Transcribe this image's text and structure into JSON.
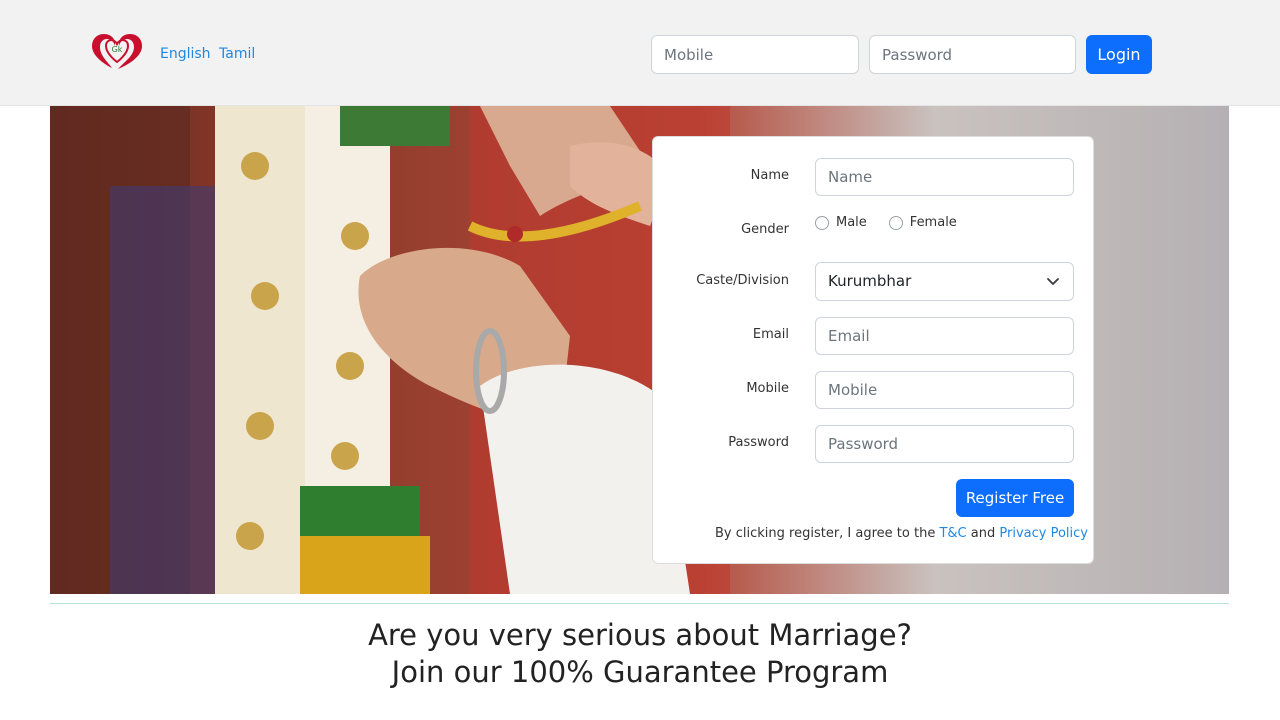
{
  "header": {
    "logo_text": "Gk",
    "languages": [
      "English",
      "Tamil"
    ],
    "mobile_placeholder": "Mobile",
    "password_placeholder": "Password",
    "login_label": "Login"
  },
  "registration": {
    "name_label": "Name",
    "name_placeholder": "Name",
    "gender_label": "Gender",
    "gender_options": [
      "Male",
      "Female"
    ],
    "caste_label": "Caste/Division",
    "caste_selected": "Kurumbhar",
    "email_label": "Email",
    "email_placeholder": "Email",
    "mobile_label": "Mobile",
    "mobile_placeholder": "Mobile",
    "password_label": "Password",
    "password_placeholder": "Password",
    "register_label": "Register Free",
    "terms_prefix": "By clicking register, I agree to the",
    "terms_link": "T&C",
    "terms_middle": "and",
    "privacy_link": "Privacy Policy"
  },
  "promo": {
    "line1": "Are you very serious about Marriage?",
    "line2": "Join our 100% Guarantee Program"
  },
  "colors": {
    "primary": "#0d6efd",
    "link": "#1e88e5",
    "logo": "#c8102e",
    "logo_text": "#2e7d32"
  }
}
